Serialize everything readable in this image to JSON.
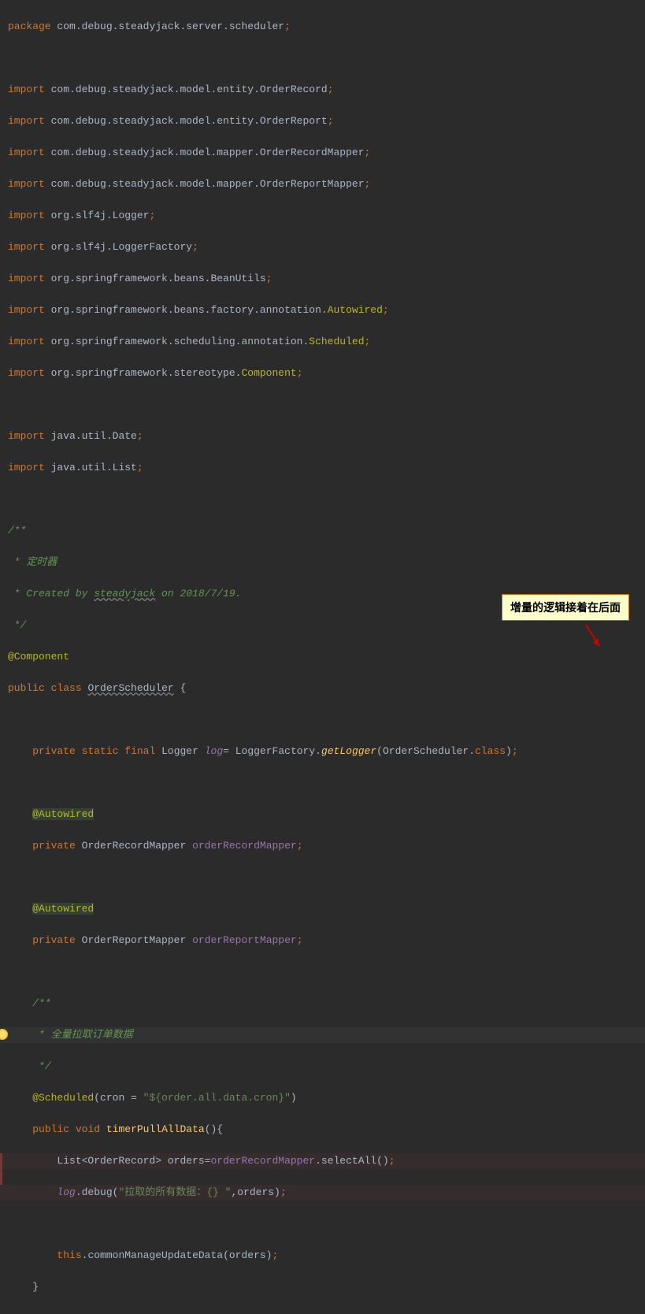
{
  "pkg": {
    "kw": "package",
    "path": "com.debug.steadyjack.server.scheduler"
  },
  "imports": [
    {
      "path": "com.debug.steadyjack.model.entity.OrderRecord"
    },
    {
      "path": "com.debug.steadyjack.model.entity.OrderReport"
    },
    {
      "path": "com.debug.steadyjack.model.mapper.OrderRecordMapper"
    },
    {
      "path": "com.debug.steadyjack.model.mapper.OrderReportMapper"
    },
    {
      "path": "org.slf4j.Logger"
    },
    {
      "path": "org.slf4j.LoggerFactory"
    },
    {
      "path": "org.springframework.beans.BeanUtils"
    },
    {
      "path": "org.springframework.beans.factory.annotation.",
      "cls": "Autowired"
    },
    {
      "path": "org.springframework.scheduling.annotation.",
      "cls": "Scheduled"
    },
    {
      "path": "org.springframework.stereotype.",
      "cls": "Component"
    }
  ],
  "imports2": [
    {
      "path": "java.util.Date"
    },
    {
      "path": "java.util.List"
    }
  ],
  "doc1": {
    "l1": "/**",
    "l2": " * 定时器",
    "l3": " * Created by ",
    "author": "steadyjack",
    "l3b": " on 2018/7/19.",
    "l4": " */"
  },
  "ann_component": "@Component",
  "classdecl": {
    "kw1": "public",
    "kw2": "class",
    "name": "OrderScheduler",
    "brace": " {"
  },
  "logline": {
    "kw1": "private",
    "kw2": "static",
    "kw3": "final",
    "type": "Logger",
    "field": "log",
    "eq": "= LoggerFactory.",
    "method": "getLogger",
    "arg": "(OrderScheduler.",
    "kw4": "class",
    "end": ")"
  },
  "ann_autowired": "@Autowired",
  "field1": {
    "kw": "private",
    "type": "OrderRecordMapper",
    "name": "orderRecordMapper"
  },
  "field2": {
    "kw": "private",
    "type": "OrderReportMapper",
    "name": "orderReportMapper"
  },
  "doc2": {
    "l1": "/**",
    "l2": " * 全量拉取订单数据",
    "l3": " */"
  },
  "sched": {
    "ann": "@Scheduled",
    "open": "(cron = ",
    "str": "\"${order.all.data.cron}\"",
    "close": ")"
  },
  "method1": {
    "kw1": "public",
    "kw2": "void",
    "name": "timerPullAllData",
    "sig": "(){"
  },
  "body1": {
    "pre": "List<OrderRecord> orders=",
    "field": "orderRecordMapper",
    "call": ".selectAll()"
  },
  "body2": {
    "field": "log",
    "call": ".debug(",
    "str": "\"拉取的所有数据：{} \"",
    "post": ",orders)"
  },
  "body3": {
    "kw": "this",
    "call": ".commonManageUpdateData(orders)"
  },
  "brace_close": "}",
  "callout": "增量的逻辑接着在后面",
  "kw_import": "import"
}
